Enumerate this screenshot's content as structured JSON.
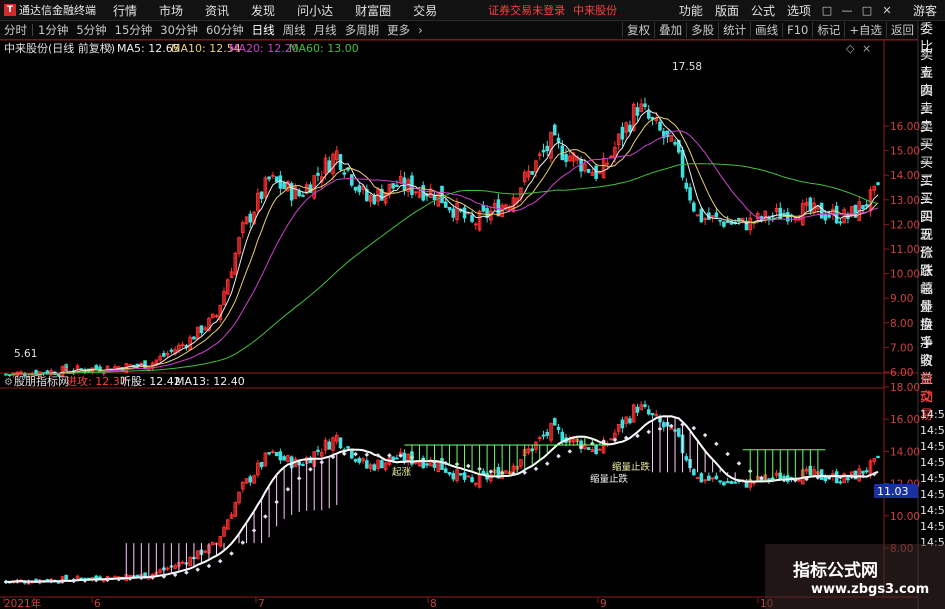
{
  "app": {
    "title": "通达信金融终端",
    "logo_glyph": "T",
    "menu": [
      "行情",
      "市场",
      "资讯",
      "发现",
      "问小达",
      "财富圈",
      "交易"
    ],
    "alert": "证券交易未登录",
    "stock_name": "中来股份",
    "right_menu": [
      "功能",
      "版面",
      "公式",
      "选项"
    ],
    "window_controls": [
      "□",
      "—",
      "□",
      "✕"
    ],
    "guest": "游客"
  },
  "toolbar": {
    "periods": [
      "分时",
      "1分钟",
      "5分钟",
      "15分钟",
      "30分钟",
      "60分钟",
      "日线",
      "周线",
      "月线",
      "多周期",
      "更多"
    ],
    "active_period": "日线",
    "right": [
      "复权",
      "叠加",
      "多股",
      "统计",
      "画线",
      "F10",
      "标记",
      "+自选",
      "返回"
    ]
  },
  "side_tabs": [
    "委比",
    "卖五",
    "卖四",
    "卖三",
    "卖二",
    "卖一",
    "买一",
    "买二",
    "买三",
    "买四",
    "买五",
    "现价",
    "涨跌",
    "涨幅",
    "总量",
    "外盘",
    "换手",
    "净资",
    "收益",
    "自动",
    "交易",
    "14:56",
    "14:56",
    "14:56",
    "14:56",
    "14:56",
    "14:56",
    "14:56",
    "14:56",
    "14:56"
  ],
  "colors": {
    "up": "#ff3030",
    "down": "#40e0e0",
    "ma5": "#f0f0f0",
    "ma10": "#e8d070",
    "ma20": "#d040d0",
    "ma60": "#40c040",
    "panel_line": "#8b1a1a",
    "axis_text": "#d04040",
    "green_bar": "#70ff70",
    "pink_bar": "#ffd0ff"
  },
  "main_chart": {
    "header": "中来股份(日线 前复权)",
    "ma5_label": "MA5: 12.65",
    "ma10_label": "MA10: 12.54",
    "ma20_label": "MA20: 12.20",
    "ma60_label": "MA60: 13.00",
    "y_ticks": [
      "16.00",
      "15.00",
      "14.00",
      "13.00",
      "12.00",
      "11.00",
      "10.00",
      "9.00",
      "8.00",
      "7.00",
      "6.00"
    ],
    "high_label": "17.58",
    "low_label": "5.61"
  },
  "sub_chart": {
    "name": "股朋指标网",
    "label1": "进攻: 12.37",
    "label2": "听股: 12.42",
    "label3": "MA13: 12.40",
    "y_ticks": [
      "18.00",
      "16.00",
      "14.00",
      "12.00",
      "10.00",
      "8.00"
    ],
    "price_tag": "11.03",
    "annotation_a": "起涨",
    "annotation_b": "缩量止跌",
    "annotation_c": "缩量止跌"
  },
  "x_axis": [
    "2021年",
    "6",
    "7",
    "8",
    "9",
    "10"
  ],
  "watermark": {
    "line1": "指标公式网",
    "line2": "www.zbgs3.com"
  },
  "chart_data": {
    "type": "candlestick",
    "title": "中来股份(日线 前复权)",
    "ylim": [
      5.5,
      18.0
    ],
    "x": [
      "2021年",
      "6",
      "7",
      "8",
      "9",
      "10"
    ],
    "series": [
      {
        "name": "MA5",
        "last": 12.65
      },
      {
        "name": "MA10",
        "last": 12.54
      },
      {
        "name": "MA20",
        "last": 12.2
      },
      {
        "name": "MA60",
        "last": 13.0
      }
    ],
    "annotations": [
      {
        "label": "17.58",
        "type": "high"
      },
      {
        "label": "5.61",
        "type": "low"
      }
    ]
  }
}
